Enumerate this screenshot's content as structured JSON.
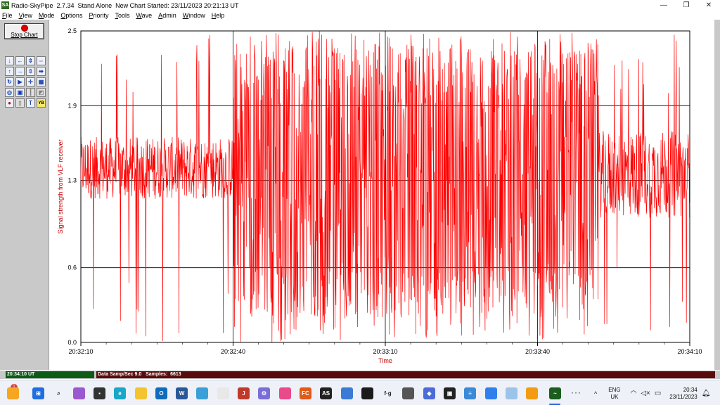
{
  "window": {
    "app_icon_text": "SA",
    "title": "Radio-SkyPipe  2.7.34  Stand Alone  New Chart Started: 23/11/2023 20:21:13 UT",
    "controls": {
      "minimize": "—",
      "maximize": "❐",
      "close": "✕"
    }
  },
  "menu": {
    "items": [
      {
        "u": "F",
        "rest": "ile"
      },
      {
        "u": "V",
        "rest": "iew"
      },
      {
        "u": "M",
        "rest": "ode"
      },
      {
        "u": "O",
        "rest": "ptions"
      },
      {
        "u": "P",
        "rest": "riority"
      },
      {
        "u": "T",
        "rest": "ools"
      },
      {
        "u": "W",
        "rest": "ave"
      },
      {
        "u": "A",
        "rest": "dmin"
      },
      {
        "u": "W",
        "rest": "indow"
      },
      {
        "u": "H",
        "rest": "elp"
      }
    ]
  },
  "toolbar": {
    "stop_label": "Stop Chart",
    "tools": [
      {
        "glyph": "↓",
        "name": "scroll-down-icon",
        "cls": ""
      },
      {
        "glyph": "←",
        "name": "scroll-left-icon",
        "cls": ""
      },
      {
        "glyph": "⇕",
        "name": "expand-vertical-icon",
        "cls": ""
      },
      {
        "glyph": "⇔",
        "name": "expand-horizontal-icon",
        "cls": ""
      },
      {
        "glyph": "↑",
        "name": "scroll-up-icon",
        "cls": ""
      },
      {
        "glyph": "→",
        "name": "scroll-right-icon",
        "cls": ""
      },
      {
        "glyph": "⇳",
        "name": "compress-vertical-icon",
        "cls": ""
      },
      {
        "glyph": "⇹",
        "name": "compress-horizontal-icon",
        "cls": ""
      },
      {
        "glyph": "↻",
        "name": "refresh-icon",
        "cls": ""
      },
      {
        "glyph": "▶",
        "name": "play-icon",
        "cls": ""
      },
      {
        "glyph": "✛",
        "name": "crosshair-icon",
        "cls": ""
      },
      {
        "glyph": "▦",
        "name": "grid-icon",
        "cls": ""
      },
      {
        "glyph": "◎",
        "name": "target-icon",
        "cls": ""
      },
      {
        "glyph": "▣",
        "name": "box-icon",
        "cls": ""
      },
      {
        "glyph": "┃",
        "name": "bar-icon",
        "cls": "gray"
      },
      {
        "glyph": "◩",
        "name": "image-icon",
        "cls": "gray"
      },
      {
        "glyph": "●",
        "name": "record-icon",
        "cls": "red"
      },
      {
        "glyph": "▯",
        "name": "page-icon",
        "cls": "gray"
      },
      {
        "glyph": "T",
        "name": "text-icon",
        "cls": ""
      },
      {
        "glyph": "YB",
        "name": "yb-icon",
        "cls": "yb"
      }
    ]
  },
  "chart_data": {
    "type": "line",
    "title": "",
    "xlabel": "Time",
    "ylabel": "Signal strength from VLF receiver",
    "ylim": [
      0.0,
      2.5
    ],
    "yticks": [
      "2.5",
      "1.9",
      "1.3",
      "0.6",
      "0.0"
    ],
    "ytick_values": [
      2.5,
      1.9,
      1.3,
      0.6,
      0.0
    ],
    "xticks": [
      "20:32:10",
      "20:32:40",
      "20:33:10",
      "20:33:40",
      "20:34:10"
    ],
    "xlim_seconds": [
      0,
      120
    ],
    "grid": true,
    "series": [
      {
        "color": "#ff0000",
        "summary": "high-rate VLF signal; ~1.2–1.7 band with spikes 20:32:10–20:32:40, large oscillations 0.1–2.5 from 20:32:40 to ~20:33:50, then ~1.0–1.7 band",
        "segments": [
          {
            "t0": 0,
            "t1": 30,
            "mean": 1.4,
            "spread": 0.25,
            "spike_prob": 0.06
          },
          {
            "t0": 30,
            "t1": 102,
            "mean": 1.3,
            "spread": 1.1,
            "spike_prob": 0.35
          },
          {
            "t0": 102,
            "t1": 120,
            "mean": 1.35,
            "spread": 0.35,
            "spike_prob": 0.08
          }
        ]
      }
    ]
  },
  "status": {
    "time": "20:34:10 UT",
    "info": "Data Samp/Sec 9.0   Samples:  6613"
  },
  "taskbar": {
    "badge": "1",
    "dots": "···",
    "caret": "^",
    "lang_line1": "ENG",
    "lang_line2": "UK",
    "clock_time": "20:34",
    "clock_date": "23/11/2023",
    "apps": [
      {
        "name": "widgets-icon",
        "color": "#f5a623",
        "text": ""
      },
      {
        "name": "start-icon",
        "color": "#1f6fe0",
        "text": "⊞"
      },
      {
        "name": "search-icon",
        "color": "#eef1f7",
        "text": "⌕"
      },
      {
        "name": "copilot-icon",
        "color": "#9b59d0",
        "text": ""
      },
      {
        "name": "task-view-icon",
        "color": "#333333",
        "text": "▪"
      },
      {
        "name": "edge-icon",
        "color": "#1aa6c9",
        "text": "e"
      },
      {
        "name": "explorer-icon",
        "color": "#f4c430",
        "text": ""
      },
      {
        "name": "outlook-icon",
        "color": "#0f6cbd",
        "text": "O"
      },
      {
        "name": "word-icon",
        "color": "#2b5797",
        "text": "W"
      },
      {
        "name": "remote-desktop-icon",
        "color": "#3aa0d8",
        "text": ""
      },
      {
        "name": "notes-icon",
        "color": "#e8e8e8",
        "text": ""
      },
      {
        "name": "shield-icon",
        "color": "#c0392b",
        "text": "J"
      },
      {
        "name": "settings-gear-icon",
        "color": "#7a6fd8",
        "text": "⚙"
      },
      {
        "name": "photos-icon",
        "color": "#e84a8a",
        "text": ""
      },
      {
        "name": "fc-app-icon",
        "color": "#e05a1a",
        "text": "FC"
      },
      {
        "name": "as-app-icon",
        "color": "#222222",
        "text": "AS"
      },
      {
        "name": "map-app-icon",
        "color": "#3a7bd5",
        "text": ""
      },
      {
        "name": "chart-app-icon",
        "color": "#1b1b1b",
        "text": ""
      },
      {
        "name": "fg-app-icon",
        "color": "#eef1f7",
        "text": "f·g"
      },
      {
        "name": "pen-app-icon",
        "color": "#555555",
        "text": ""
      },
      {
        "name": "gem-app-icon",
        "color": "#4b6bd8",
        "text": "◆"
      },
      {
        "name": "frame-app-icon",
        "color": "#222222",
        "text": "▣"
      },
      {
        "name": "list-app-icon",
        "color": "#3a8ad8",
        "text": "≡"
      },
      {
        "name": "globe-app-icon",
        "color": "#2f80ed",
        "text": ""
      },
      {
        "name": "pictures-app-icon",
        "color": "#9cc3e8",
        "text": ""
      },
      {
        "name": "headphones-icon",
        "color": "#f39c12",
        "text": ""
      },
      {
        "name": "skypipe-taskbar-icon",
        "color": "#1b5e20",
        "text": "~"
      }
    ]
  }
}
